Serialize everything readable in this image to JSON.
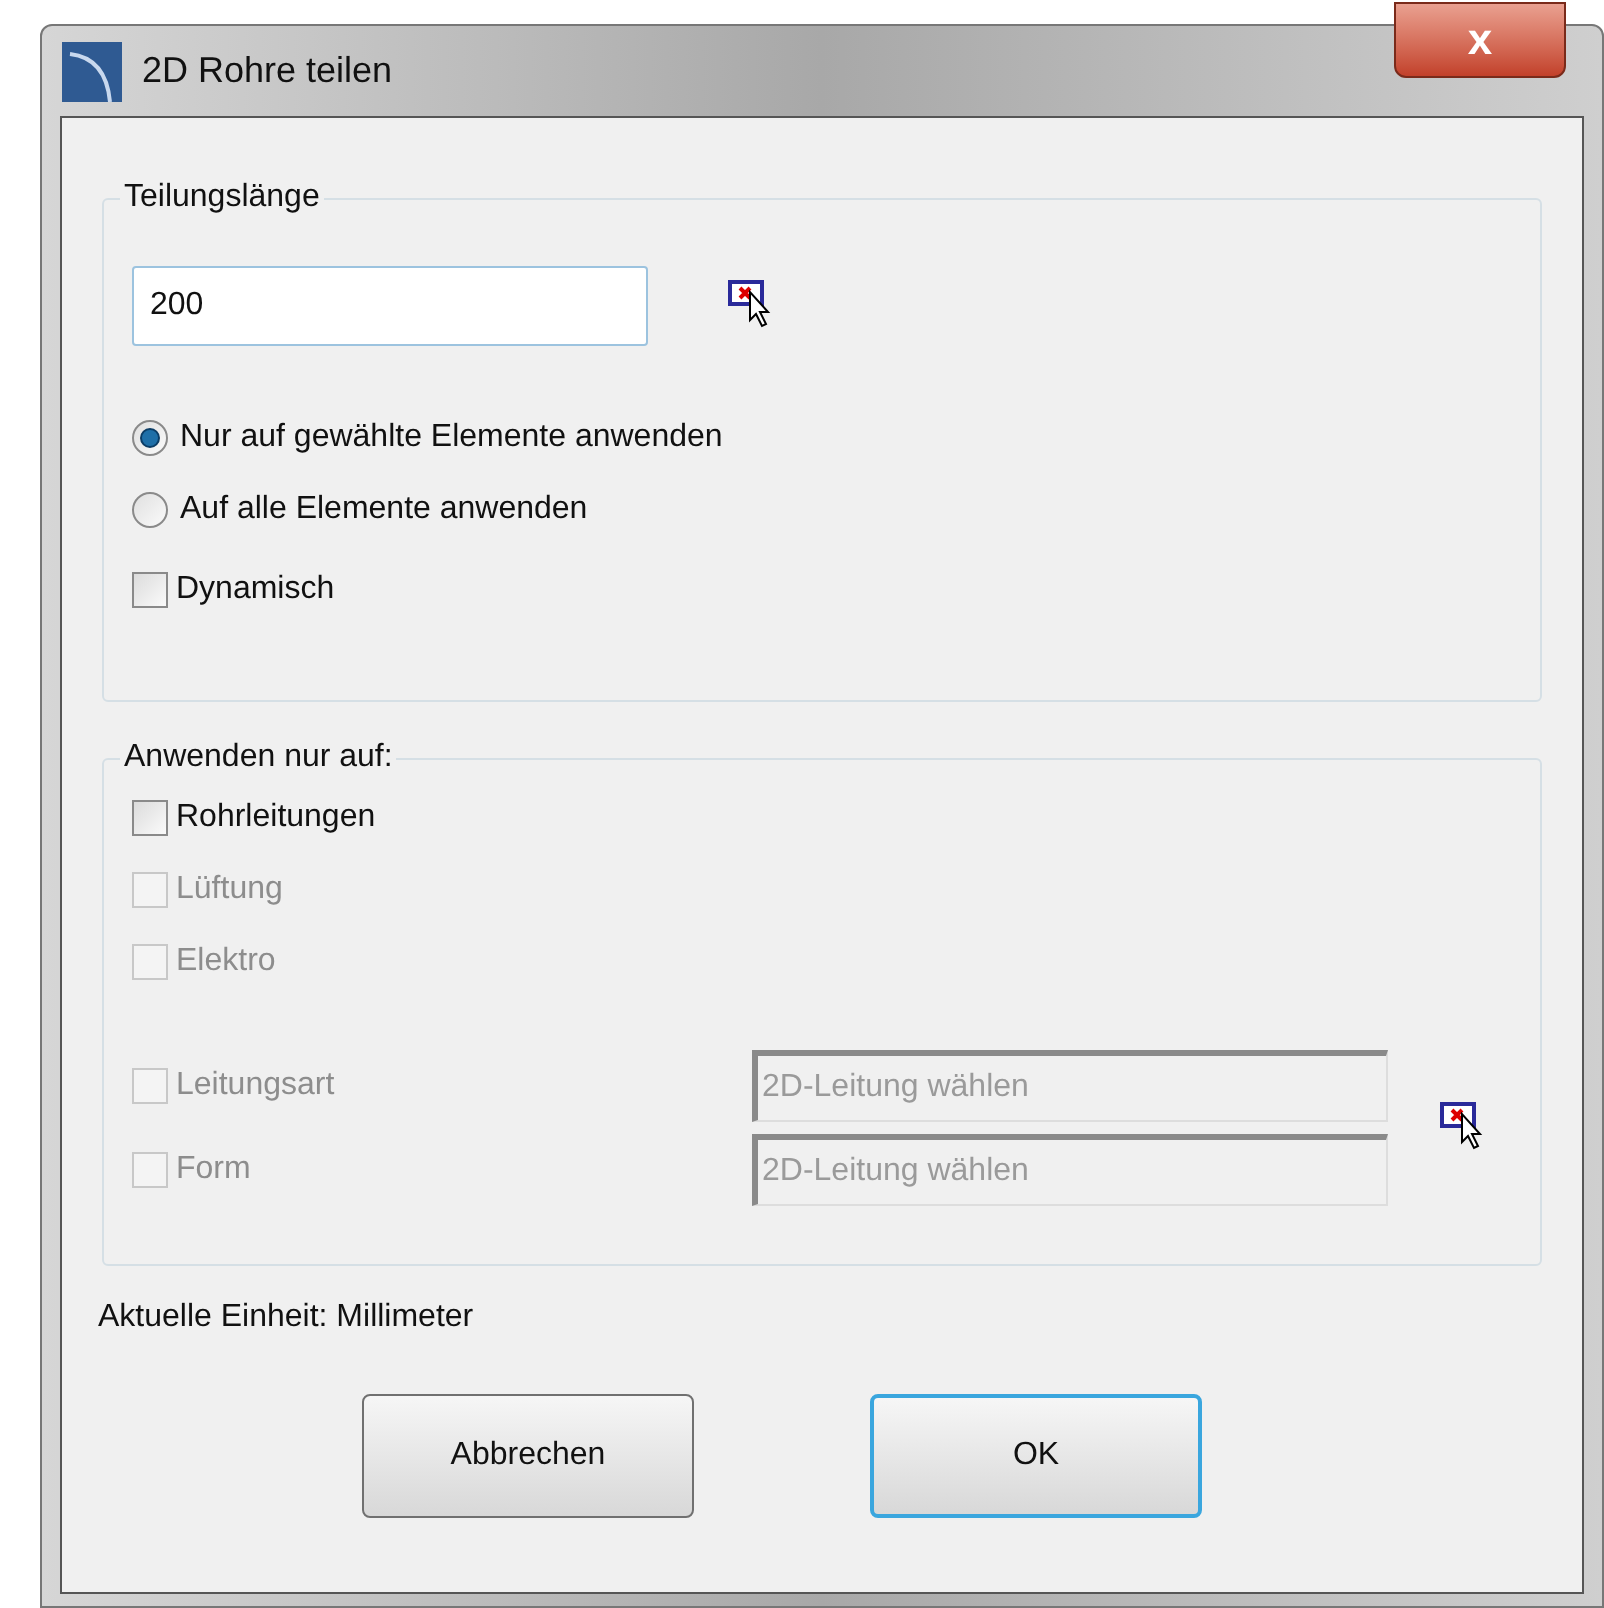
{
  "window": {
    "title": "2D Rohre teilen",
    "close_label": "x"
  },
  "division_group": {
    "title": "Teilungslänge",
    "length": {
      "value": "200"
    },
    "scope": [
      {
        "label": "Nur auf gewählte Elemente anwenden",
        "selected": true
      },
      {
        "label": "Auf alle Elemente anwenden",
        "selected": false
      }
    ],
    "dynamic": {
      "label": "Dynamisch",
      "checked": false
    }
  },
  "apply_group": {
    "title": "Anwenden nur auf:",
    "types": [
      {
        "label": "Rohrleitungen",
        "checked": false,
        "disabled": false
      },
      {
        "label": "Lüftung",
        "checked": false,
        "disabled": true
      },
      {
        "label": "Elektro",
        "checked": false,
        "disabled": true
      }
    ],
    "filters": [
      {
        "label": "Leitungsart",
        "checked": false,
        "disabled": true,
        "placeholder": "2D-Leitung wählen"
      },
      {
        "label": "Form",
        "checked": false,
        "disabled": true,
        "placeholder": "2D-Leitung wählen"
      }
    ]
  },
  "unit_label": "Aktuelle Einheit: Millimeter",
  "buttons": [
    {
      "label": "Abbrechen",
      "focused": false
    },
    {
      "label": "OK",
      "focused": true
    }
  ]
}
